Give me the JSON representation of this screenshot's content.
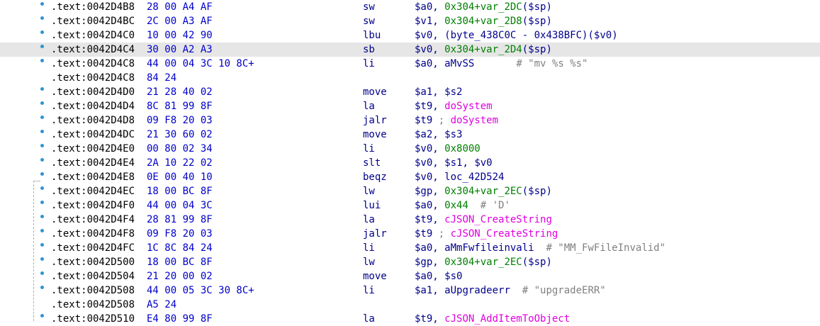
{
  "colors": {
    "address": "#000000",
    "bytes": "#0000cc",
    "mnemonic": "#00008b",
    "register": "#00008b",
    "number": "#008000",
    "function_name": "#e000e0",
    "comment": "#808080",
    "highlight_row": "#e6e6e6",
    "breakpoint_dot": "#2e95d3"
  },
  "rows": [
    {
      "addr": ".text:0042D4B8",
      "bytes": "28 00 A4 AF",
      "mnem": "sw",
      "ops": [
        {
          "t": "reg",
          "v": "$a0"
        },
        {
          "t": "punc",
          "v": ", "
        },
        {
          "t": "num",
          "v": "0x304+var_2DC"
        },
        {
          "t": "punc",
          "v": "("
        },
        {
          "t": "reg",
          "v": "$sp"
        },
        {
          "t": "punc",
          "v": ")"
        }
      ],
      "dot": true
    },
    {
      "addr": ".text:0042D4BC",
      "bytes": "2C 00 A3 AF",
      "mnem": "sw",
      "ops": [
        {
          "t": "reg",
          "v": "$v1"
        },
        {
          "t": "punc",
          "v": ", "
        },
        {
          "t": "num",
          "v": "0x304+var_2D8"
        },
        {
          "t": "punc",
          "v": "("
        },
        {
          "t": "reg",
          "v": "$sp"
        },
        {
          "t": "punc",
          "v": ")"
        }
      ],
      "dot": true
    },
    {
      "addr": ".text:0042D4C0",
      "bytes": "10 00 42 90",
      "mnem": "lbu",
      "ops": [
        {
          "t": "reg",
          "v": "$v0"
        },
        {
          "t": "punc",
          "v": ", "
        },
        {
          "t": "sym",
          "v": "(byte_438C0C - 0x438BFC)"
        },
        {
          "t": "punc",
          "v": "("
        },
        {
          "t": "reg",
          "v": "$v0"
        },
        {
          "t": "punc",
          "v": ")"
        }
      ],
      "dot": true
    },
    {
      "addr": ".text:0042D4C4",
      "bytes": "30 00 A2 A3",
      "mnem": "sb",
      "ops": [
        {
          "t": "reg",
          "v": "$v0"
        },
        {
          "t": "punc",
          "v": ", "
        },
        {
          "t": "num",
          "v": "0x304+var_2D4"
        },
        {
          "t": "punc",
          "v": "("
        },
        {
          "t": "reg",
          "v": "$sp"
        },
        {
          "t": "punc",
          "v": ")"
        }
      ],
      "dot": true,
      "highlight": true
    },
    {
      "addr": ".text:0042D4C8",
      "bytes": "44 00 04 3C 10 8C+",
      "mnem": "li",
      "ops": [
        {
          "t": "reg",
          "v": "$a0"
        },
        {
          "t": "punc",
          "v": ", "
        },
        {
          "t": "sym",
          "v": "aMvSS"
        },
        {
          "t": "punc",
          "v": "       "
        },
        {
          "t": "cmt",
          "v": "# \"mv %s %s\""
        }
      ],
      "dot": true
    },
    {
      "addr": ".text:0042D4C8",
      "bytes": "84 24",
      "mnem": "",
      "ops": [],
      "dot": false
    },
    {
      "addr": ".text:0042D4D0",
      "bytes": "21 28 40 02",
      "mnem": "move",
      "ops": [
        {
          "t": "reg",
          "v": "$a1"
        },
        {
          "t": "punc",
          "v": ", "
        },
        {
          "t": "reg",
          "v": "$s2"
        }
      ],
      "dot": true
    },
    {
      "addr": ".text:0042D4D4",
      "bytes": "8C 81 99 8F",
      "mnem": "la",
      "ops": [
        {
          "t": "reg",
          "v": "$t9"
        },
        {
          "t": "punc",
          "v": ", "
        },
        {
          "t": "func",
          "v": "doSystem"
        }
      ],
      "dot": true
    },
    {
      "addr": ".text:0042D4D8",
      "bytes": "09 F8 20 03",
      "mnem": "jalr",
      "ops": [
        {
          "t": "reg",
          "v": "$t9"
        },
        {
          "t": "cmt",
          "v": " ; "
        },
        {
          "t": "func",
          "v": "doSystem"
        }
      ],
      "dot": true
    },
    {
      "addr": ".text:0042D4DC",
      "bytes": "21 30 60 02",
      "mnem": "move",
      "ops": [
        {
          "t": "reg",
          "v": "$a2"
        },
        {
          "t": "punc",
          "v": ", "
        },
        {
          "t": "reg",
          "v": "$s3"
        }
      ],
      "dot": true
    },
    {
      "addr": ".text:0042D4E0",
      "bytes": "00 80 02 34",
      "mnem": "li",
      "ops": [
        {
          "t": "reg",
          "v": "$v0"
        },
        {
          "t": "punc",
          "v": ", "
        },
        {
          "t": "num",
          "v": "0x8000"
        }
      ],
      "dot": true
    },
    {
      "addr": ".text:0042D4E4",
      "bytes": "2A 10 22 02",
      "mnem": "slt",
      "ops": [
        {
          "t": "reg",
          "v": "$v0"
        },
        {
          "t": "punc",
          "v": ", "
        },
        {
          "t": "reg",
          "v": "$s1"
        },
        {
          "t": "punc",
          "v": ", "
        },
        {
          "t": "reg",
          "v": "$v0"
        }
      ],
      "dot": true
    },
    {
      "addr": ".text:0042D4E8",
      "bytes": "0E 00 40 10",
      "mnem": "beqz",
      "ops": [
        {
          "t": "reg",
          "v": "$v0"
        },
        {
          "t": "punc",
          "v": ", "
        },
        {
          "t": "sym",
          "v": "loc_42D524"
        }
      ],
      "dot": true
    },
    {
      "addr": ".text:0042D4EC",
      "bytes": "18 00 BC 8F",
      "mnem": "lw",
      "ops": [
        {
          "t": "reg",
          "v": "$gp"
        },
        {
          "t": "punc",
          "v": ", "
        },
        {
          "t": "num",
          "v": "0x304+var_2EC"
        },
        {
          "t": "punc",
          "v": "("
        },
        {
          "t": "reg",
          "v": "$sp"
        },
        {
          "t": "punc",
          "v": ")"
        }
      ],
      "dot": true
    },
    {
      "addr": ".text:0042D4F0",
      "bytes": "44 00 04 3C",
      "mnem": "lui",
      "ops": [
        {
          "t": "reg",
          "v": "$a0"
        },
        {
          "t": "punc",
          "v": ", "
        },
        {
          "t": "num",
          "v": "0x44"
        },
        {
          "t": "punc",
          "v": "  "
        },
        {
          "t": "cmt",
          "v": "# 'D'"
        }
      ],
      "dot": true
    },
    {
      "addr": ".text:0042D4F4",
      "bytes": "28 81 99 8F",
      "mnem": "la",
      "ops": [
        {
          "t": "reg",
          "v": "$t9"
        },
        {
          "t": "punc",
          "v": ", "
        },
        {
          "t": "func",
          "v": "cJSON_CreateString"
        }
      ],
      "dot": true
    },
    {
      "addr": ".text:0042D4F8",
      "bytes": "09 F8 20 03",
      "mnem": "jalr",
      "ops": [
        {
          "t": "reg",
          "v": "$t9"
        },
        {
          "t": "cmt",
          "v": " ; "
        },
        {
          "t": "func",
          "v": "cJSON_CreateString"
        }
      ],
      "dot": true
    },
    {
      "addr": ".text:0042D4FC",
      "bytes": "1C 8C 84 24",
      "mnem": "li",
      "ops": [
        {
          "t": "reg",
          "v": "$a0"
        },
        {
          "t": "punc",
          "v": ", "
        },
        {
          "t": "sym",
          "v": "aMmFwfileinvali"
        },
        {
          "t": "punc",
          "v": "  "
        },
        {
          "t": "cmt",
          "v": "# \"MM_FwFileInvalid\""
        }
      ],
      "dot": true
    },
    {
      "addr": ".text:0042D500",
      "bytes": "18 00 BC 8F",
      "mnem": "lw",
      "ops": [
        {
          "t": "reg",
          "v": "$gp"
        },
        {
          "t": "punc",
          "v": ", "
        },
        {
          "t": "num",
          "v": "0x304+var_2EC"
        },
        {
          "t": "punc",
          "v": "("
        },
        {
          "t": "reg",
          "v": "$sp"
        },
        {
          "t": "punc",
          "v": ")"
        }
      ],
      "dot": true
    },
    {
      "addr": ".text:0042D504",
      "bytes": "21 20 00 02",
      "mnem": "move",
      "ops": [
        {
          "t": "reg",
          "v": "$a0"
        },
        {
          "t": "punc",
          "v": ", "
        },
        {
          "t": "reg",
          "v": "$s0"
        }
      ],
      "dot": true
    },
    {
      "addr": ".text:0042D508",
      "bytes": "44 00 05 3C 30 8C+",
      "mnem": "li",
      "ops": [
        {
          "t": "reg",
          "v": "$a1"
        },
        {
          "t": "punc",
          "v": ", "
        },
        {
          "t": "sym",
          "v": "aUpgradeerr"
        },
        {
          "t": "punc",
          "v": "  "
        },
        {
          "t": "cmt",
          "v": "# \"upgradeERR\""
        }
      ],
      "dot": true
    },
    {
      "addr": ".text:0042D508",
      "bytes": "A5 24",
      "mnem": "",
      "ops": [],
      "dot": false
    },
    {
      "addr": ".text:0042D510",
      "bytes": "E4 80 99 8F",
      "mnem": "la",
      "ops": [
        {
          "t": "reg",
          "v": "$t9"
        },
        {
          "t": "punc",
          "v": ", "
        },
        {
          "t": "func",
          "v": "cJSON_AddItemToObject"
        }
      ],
      "dot": true
    }
  ]
}
